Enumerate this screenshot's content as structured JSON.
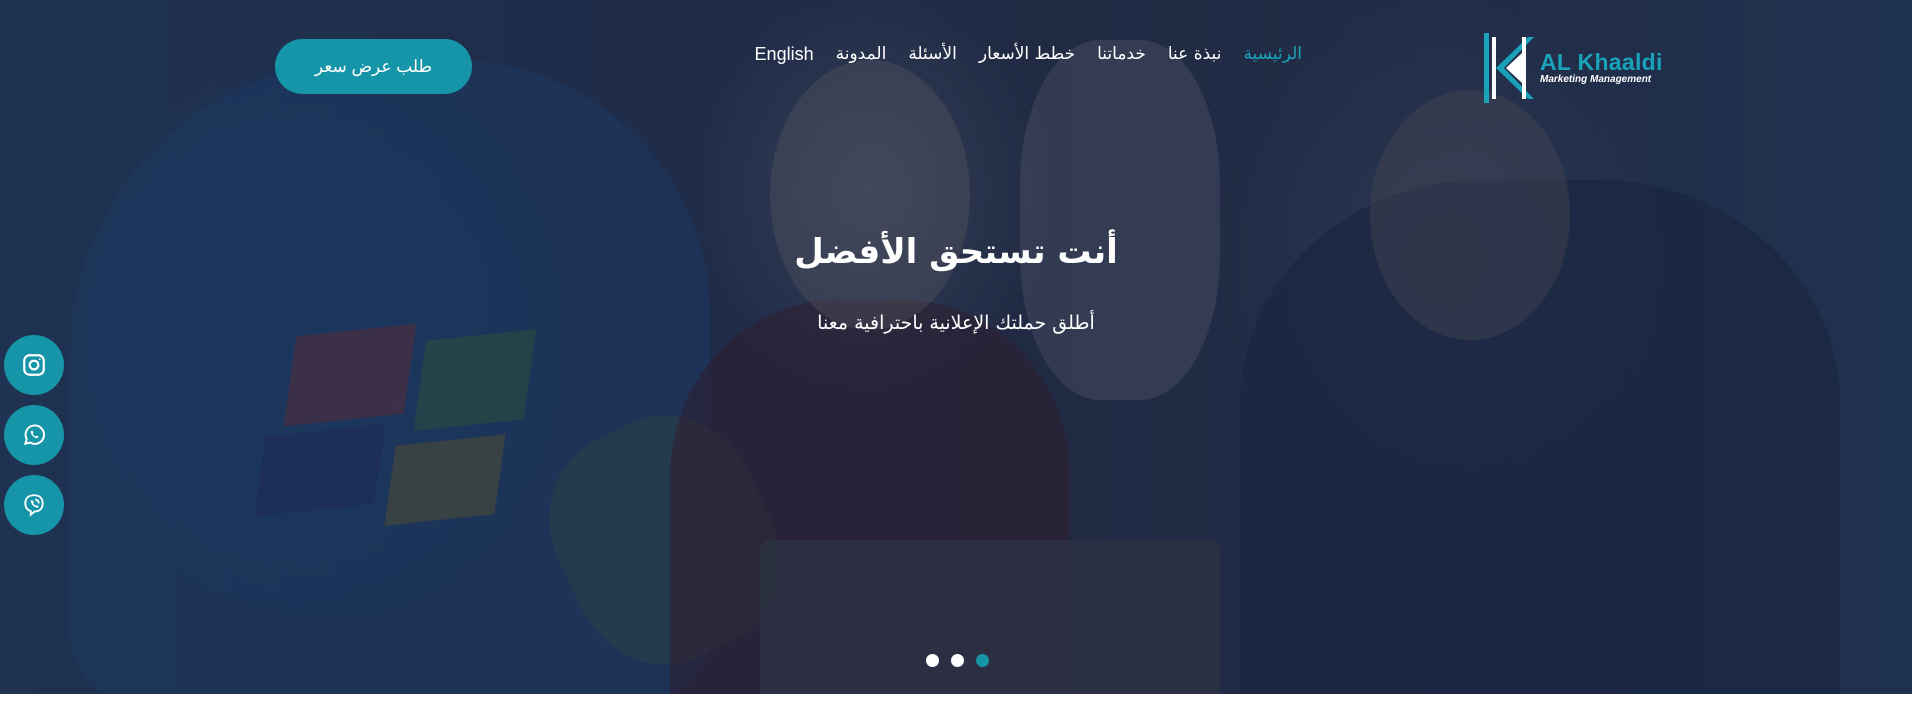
{
  "brand": {
    "name": "AL Khaaldi",
    "tagline": "Marketing Management",
    "accent_color": "#1aa3b8",
    "button_color": "#1795a8"
  },
  "nav": {
    "items": [
      {
        "label": "الرئيسية",
        "active": true
      },
      {
        "label": "نبذة عنا",
        "active": false
      },
      {
        "label": "خدماتنا",
        "active": false
      },
      {
        "label": "خطط الأسعار",
        "active": false
      },
      {
        "label": "الأسئلة",
        "active": false
      },
      {
        "label": "المدونة",
        "active": false
      }
    ],
    "language_label": "English"
  },
  "cta": {
    "label": "طلب عرض سعر"
  },
  "hero": {
    "title": "أنت تستحق الأفضل",
    "subtitle": "أطلق حملتك الإعلانية باحترافية معنا"
  },
  "slider": {
    "total_slides": 3,
    "active_slide": 3
  },
  "social": [
    {
      "icon": "instagram-icon"
    },
    {
      "icon": "whatsapp-icon"
    },
    {
      "icon": "viber-icon"
    }
  ]
}
